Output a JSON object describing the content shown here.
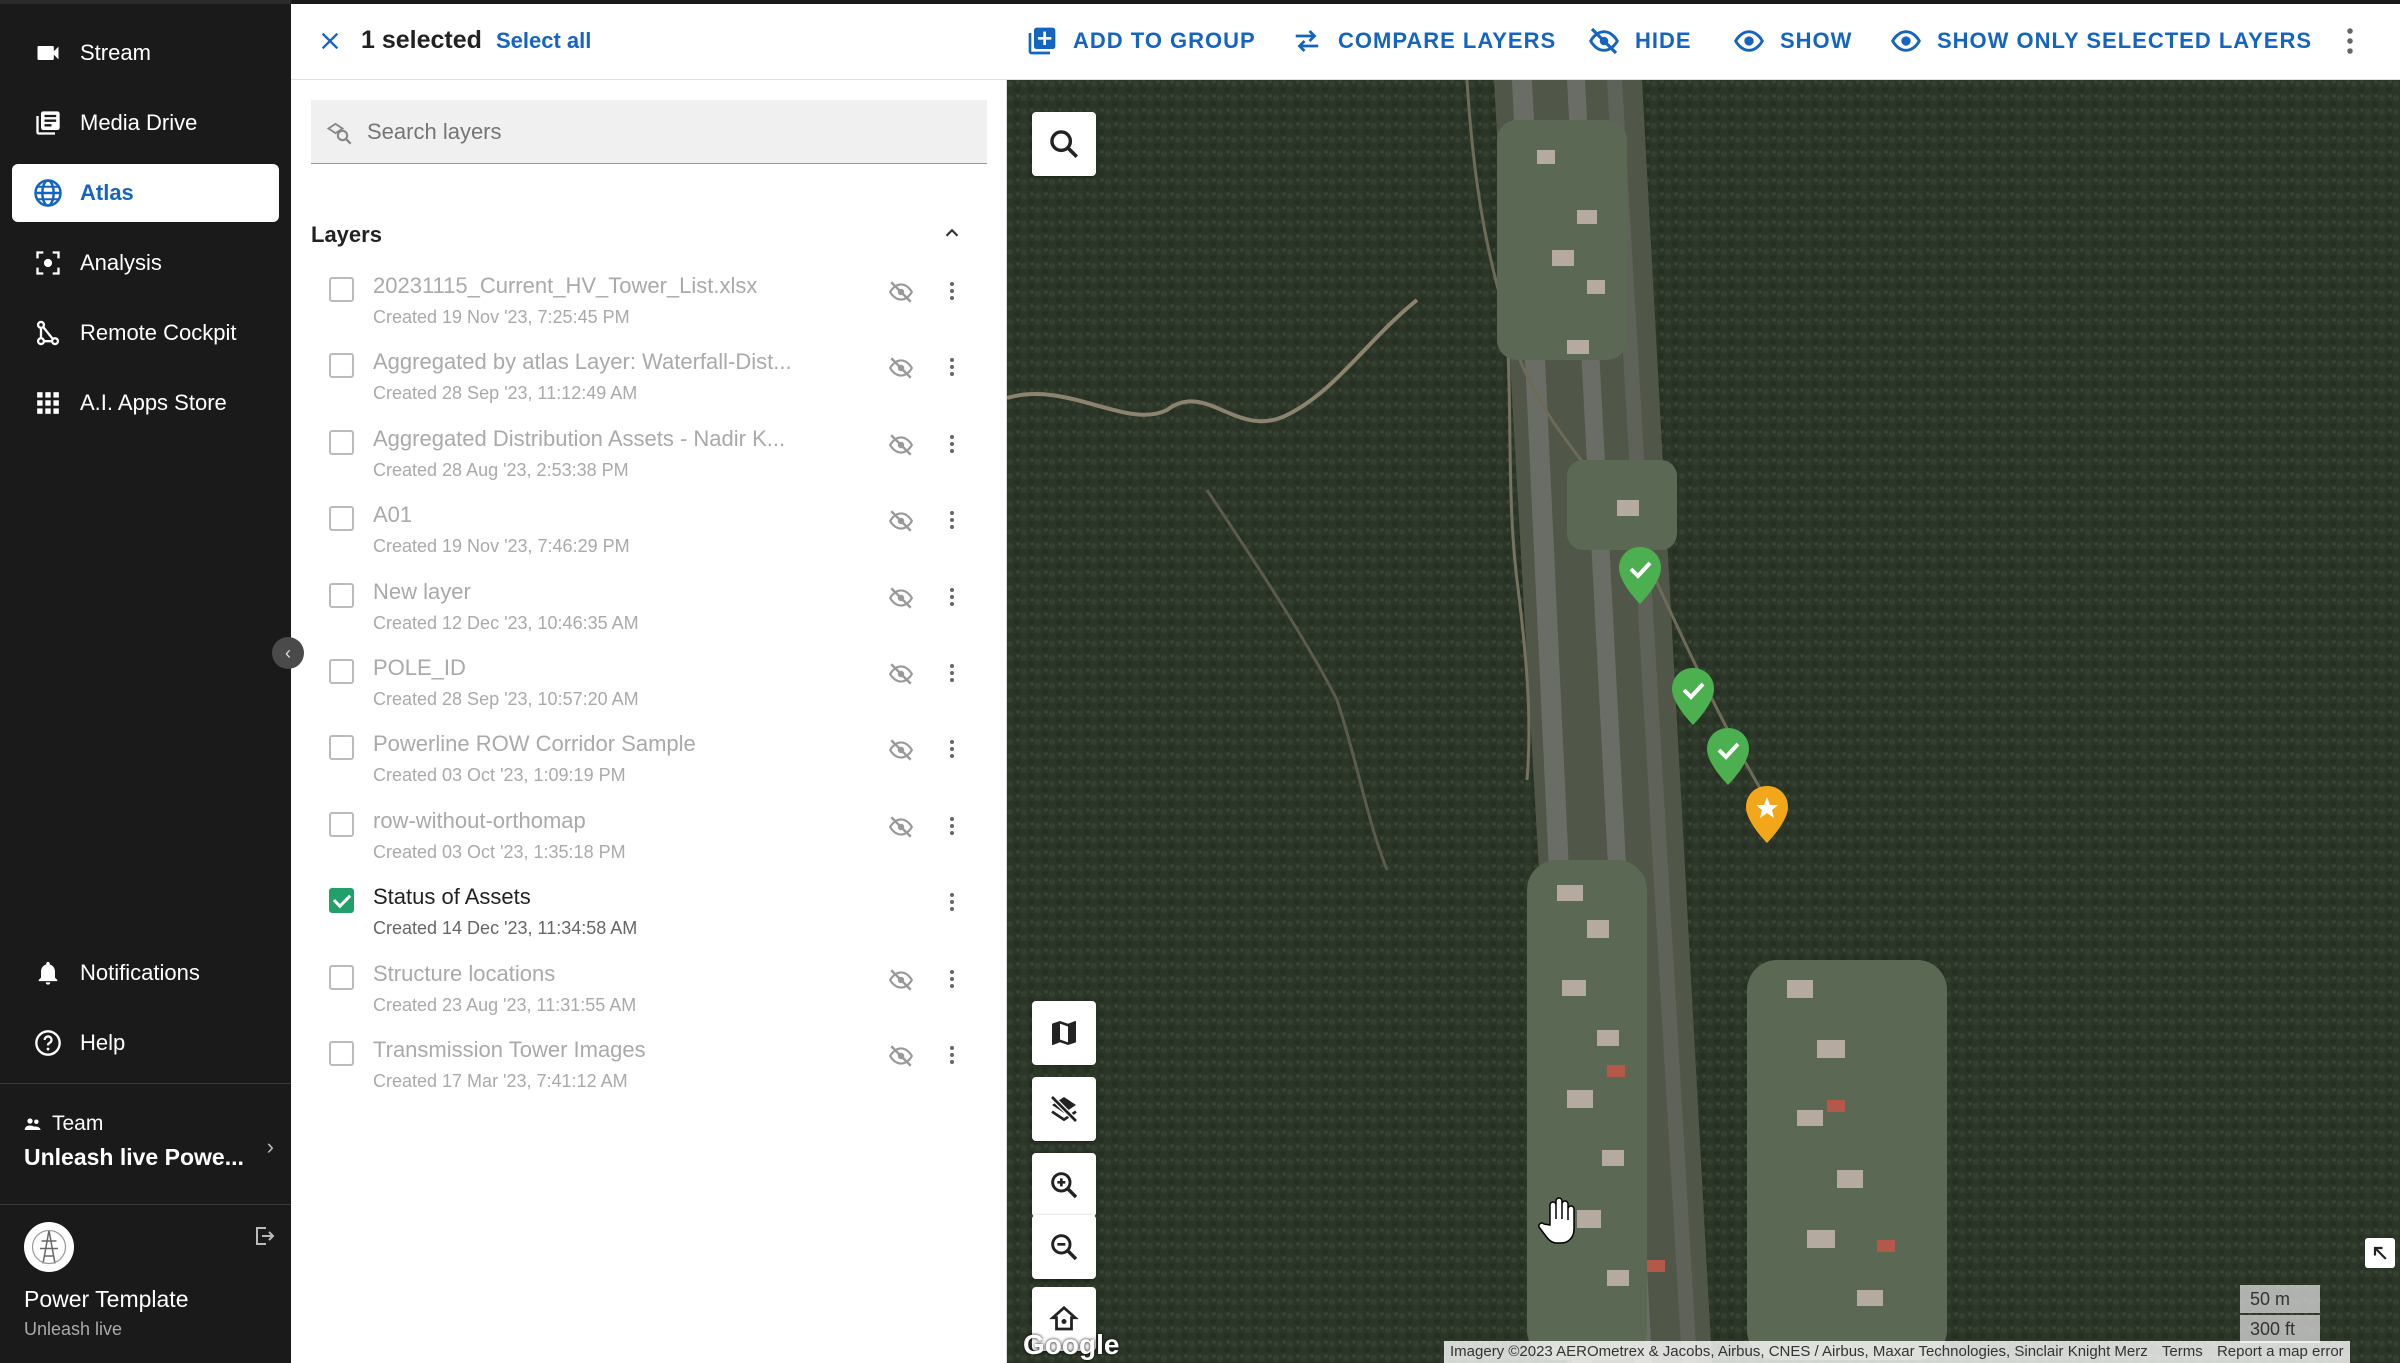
{
  "sidebar": {
    "items": [
      {
        "label": "Stream",
        "icon": "stream-camera-icon"
      },
      {
        "label": "Media Drive",
        "icon": "media-drive-icon"
      },
      {
        "label": "Atlas",
        "icon": "globe-icon"
      },
      {
        "label": "Analysis",
        "icon": "analysis-icon"
      },
      {
        "label": "Remote Cockpit",
        "icon": "remote-cockpit-icon"
      },
      {
        "label": "A.I. Apps Store",
        "icon": "apps-grid-icon"
      }
    ],
    "active_index": 2,
    "bottom_items": [
      {
        "label": "Notifications",
        "icon": "bell-icon"
      },
      {
        "label": "Help",
        "icon": "help-icon"
      }
    ],
    "team_label": "Team",
    "team_name": "Unleash live Powe...",
    "user_name": "Power Template",
    "user_sub": "Unleash live"
  },
  "topbar": {
    "selected_text": "1 selected",
    "select_all": "Select all",
    "actions": [
      {
        "label": "ADD TO GROUP",
        "icon": "add-to-group-icon"
      },
      {
        "label": "COMPARE LAYERS",
        "icon": "compare-arrows-icon"
      },
      {
        "label": "HIDE",
        "icon": "eye-off-icon"
      },
      {
        "label": "SHOW",
        "icon": "eye-icon"
      },
      {
        "label": "SHOW ONLY SELECTED LAYERS",
        "icon": "eye-icon"
      }
    ]
  },
  "panel": {
    "search_placeholder": "Search layers",
    "section_title": "Layers",
    "layers": [
      {
        "name": "20231115_Current_HV_Tower_List.xlsx",
        "date": "Created 19 Nov '23, 7:25:45 PM",
        "checked": false,
        "hidden": true
      },
      {
        "name": "Aggregated by atlas Layer: Waterfall-Dist...",
        "date": "Created 28 Sep '23, 11:12:49 AM",
        "checked": false,
        "hidden": true
      },
      {
        "name": "Aggregated Distribution Assets - Nadir K...",
        "date": "Created 28 Aug '23, 2:53:38 PM",
        "checked": false,
        "hidden": true
      },
      {
        "name": "A01",
        "date": "Created 19 Nov '23, 7:46:29 PM",
        "checked": false,
        "hidden": true
      },
      {
        "name": "New layer",
        "date": "Created 12 Dec '23, 10:46:35 AM",
        "checked": false,
        "hidden": true
      },
      {
        "name": "POLE_ID",
        "date": "Created 28 Sep '23, 10:57:20 AM",
        "checked": false,
        "hidden": true
      },
      {
        "name": "Powerline ROW Corridor Sample",
        "date": "Created 03 Oct '23, 1:09:19 PM",
        "checked": false,
        "hidden": true
      },
      {
        "name": "row-without-orthomap",
        "date": "Created 03 Oct '23, 1:35:18 PM",
        "checked": false,
        "hidden": true
      },
      {
        "name": "Status of Assets",
        "date": "Created 14 Dec '23, 11:34:58 AM",
        "checked": true,
        "hidden": false
      },
      {
        "name": "Structure locations",
        "date": "Created 23 Aug '23, 11:31:55 AM",
        "checked": false,
        "hidden": true
      },
      {
        "name": "Transmission Tower Images",
        "date": "Created 17 Mar '23, 7:41:12 AM",
        "checked": false,
        "hidden": true
      }
    ]
  },
  "map": {
    "attribution": "Imagery ©2023 AEROmetrex & Jacobs, Airbus, CNES / Airbus, Maxar Technologies, Sinclair Knight Merz",
    "terms": "Terms",
    "report": "Report a map error",
    "scale_metric": "50 m",
    "scale_imperial": "300 ft",
    "google": "Google",
    "colors": {
      "marker_ok": "#4caf50",
      "marker_star": "#f2a71b",
      "accent": "#1565c0",
      "check": "#22a06b"
    }
  }
}
